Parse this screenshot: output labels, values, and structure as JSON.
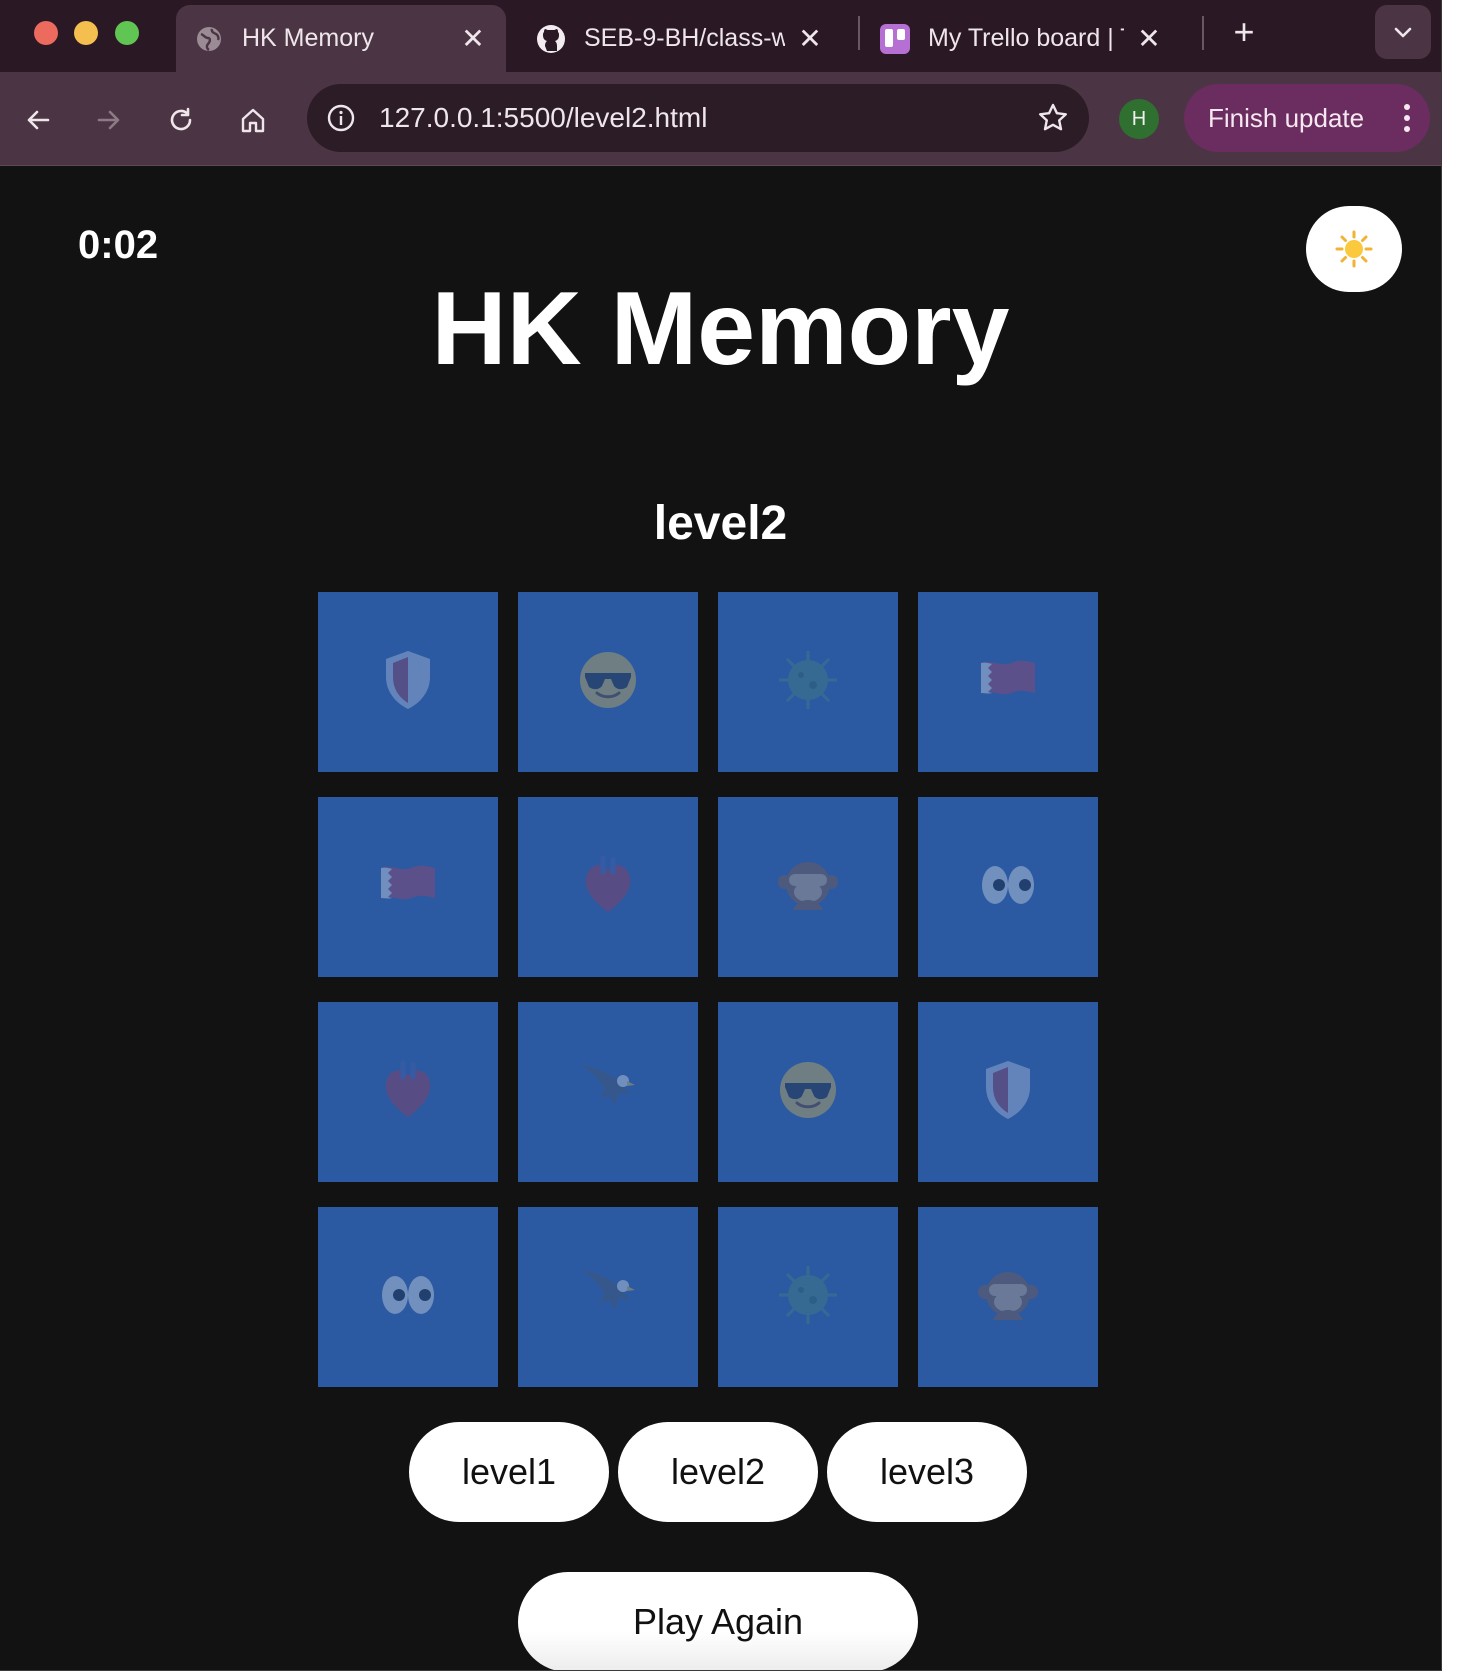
{
  "browser": {
    "tabs": [
      {
        "title": "HK Memory",
        "favicon": "globe-icon",
        "active": true
      },
      {
        "title": "SEB-9-BH/class-w",
        "favicon": "github-icon",
        "active": false
      },
      {
        "title": "My Trello board | T",
        "favicon": "trello-icon",
        "active": false
      }
    ],
    "url": "127.0.0.1:5500/level2.html",
    "profile_initial": "H",
    "update_label": "Finish update"
  },
  "game": {
    "timer": "0:02",
    "title": "HK Memory",
    "level_heading": "level2",
    "theme_icon": "sun-icon",
    "card_color": "#2c5aa2",
    "cards": [
      "shield-icon",
      "sunglasses-face-icon",
      "virus-icon",
      "flag-icon",
      "flag-icon",
      "heart-organ-icon",
      "see-no-evil-monkey-icon",
      "eyes-icon",
      "heart-organ-icon",
      "eagle-icon",
      "sunglasses-face-icon",
      "shield-icon",
      "eyes-icon",
      "eagle-icon",
      "virus-icon",
      "see-no-evil-monkey-icon"
    ],
    "level_buttons": [
      "level1",
      "level2",
      "level3"
    ],
    "play_again": "Play Again"
  }
}
